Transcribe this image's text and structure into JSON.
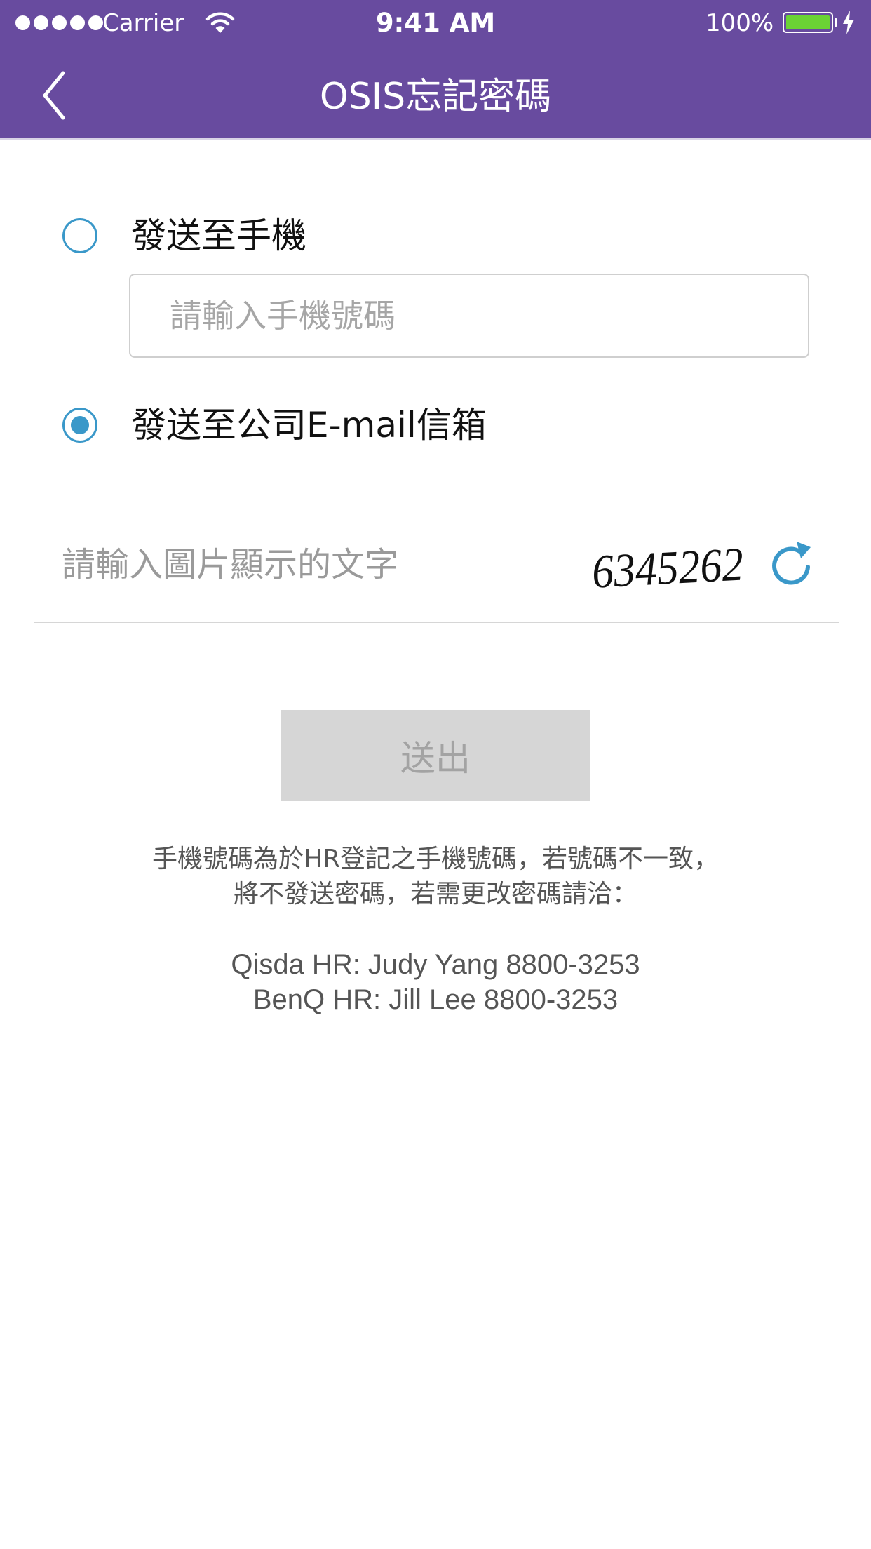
{
  "status_bar": {
    "carrier": "Carrier",
    "time": "9:41 AM",
    "battery_percent": "100%",
    "battery_level": 1.0,
    "signal_bars": 5
  },
  "nav": {
    "title": "OSIS忘記密碼",
    "back_icon": "chevron-left-icon"
  },
  "options": {
    "phone_label": "發送至手機",
    "phone_selected": false,
    "email_label": "發送至公司E-mail信箱",
    "email_selected": true
  },
  "phone_input": {
    "placeholder": "請輸入手機號碼",
    "value": ""
  },
  "captcha": {
    "placeholder": "請輸入圖片顯示的文字",
    "value": "",
    "image_text": "6345262",
    "refresh_icon": "refresh-icon"
  },
  "submit": {
    "label": "送出",
    "enabled": false
  },
  "notes": {
    "line1": "手機號碼為於HR登記之手機號碼，若號碼不一致，",
    "line2": "將不發送密碼，若需更改密碼請洽：",
    "contact1": "Qisda HR: Judy Yang 8800-3253",
    "contact2": "BenQ HR: Jill Lee 8800-3253"
  },
  "colors": {
    "header_bg": "#684b9f",
    "accent": "#3a98c9",
    "battery_fill": "#6bd335",
    "button_disabled_bg": "#d6d6d6",
    "button_disabled_text": "#a3a3a3"
  }
}
